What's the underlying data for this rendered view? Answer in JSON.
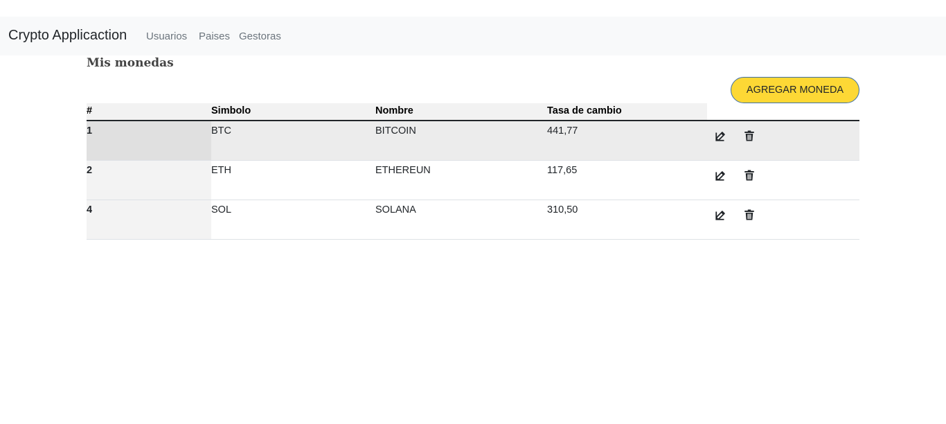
{
  "navbar": {
    "brand": "Crypto Applicaction",
    "links": [
      "Usuarios",
      "Paises",
      "Gestoras"
    ]
  },
  "page": {
    "title": "Mis monedas",
    "add_button": "AGREGAR MONEDA"
  },
  "table": {
    "headers": [
      "#",
      "Simbolo",
      "Nombre",
      "Tasa de cambio"
    ],
    "rows": [
      {
        "id": "1",
        "simbolo": "BTC",
        "nombre": "BITCOIN",
        "tasa": "441,77",
        "highlight": true
      },
      {
        "id": "2",
        "simbolo": "ETH",
        "nombre": "ETHEREUN",
        "tasa": "117,65",
        "highlight": false
      },
      {
        "id": "4",
        "simbolo": "SOL",
        "nombre": "SOLANA",
        "tasa": "310,50",
        "highlight": false
      }
    ],
    "row_actions": [
      "edit-icon",
      "trash-icon"
    ]
  },
  "colors": {
    "navbar_bg": "#f8f9fa",
    "accent_button": "#fdd835",
    "button_border": "#3b6ea8"
  }
}
